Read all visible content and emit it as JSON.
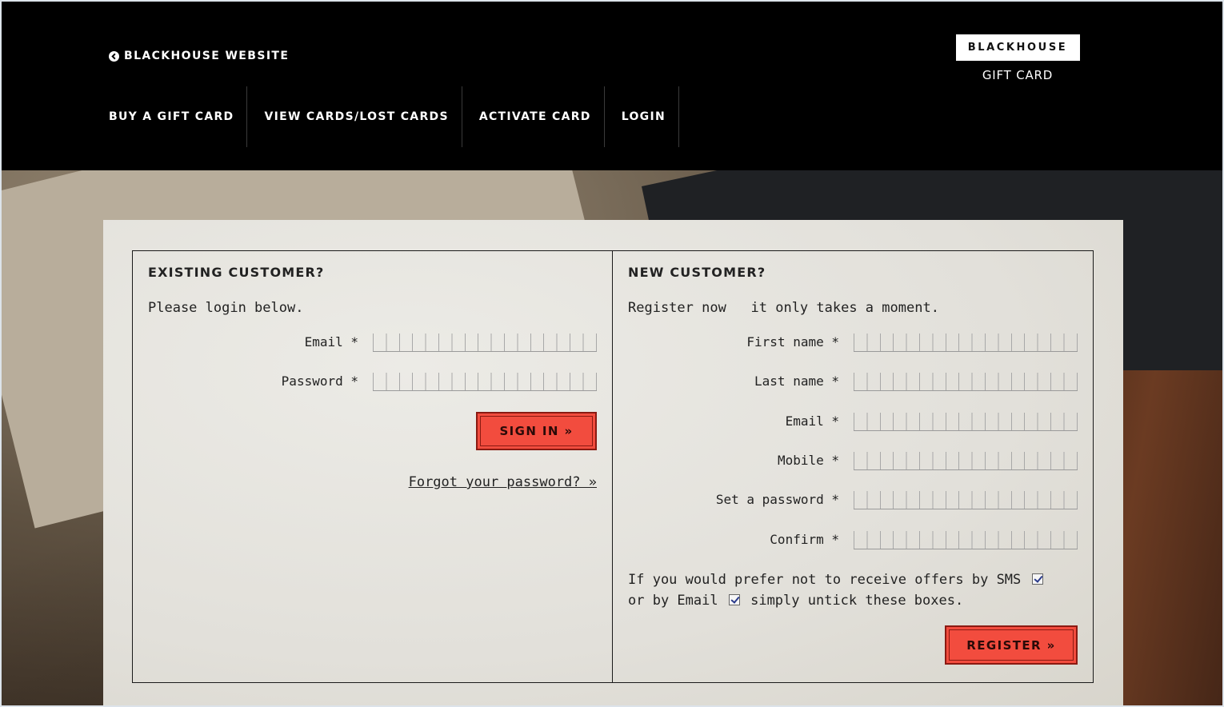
{
  "header": {
    "back_link": "BLACKHOUSE WEBSITE",
    "nav": [
      "BUY A GIFT CARD",
      "VIEW CARDS/LOST CARDS",
      "ACTIVATE CARD",
      "LOGIN"
    ],
    "logo_title": "BLACKHOUSE",
    "logo_sub": "GIFT CARD"
  },
  "existing": {
    "title": "EXISTING CUSTOMER?",
    "intro": "Please login below.",
    "fields": [
      "Email *",
      "Password *"
    ],
    "sign_in": "SIGN IN »",
    "forgot": "Forgot your password? »"
  },
  "new": {
    "title": "NEW CUSTOMER?",
    "intro": "Register now   it only takes a moment.",
    "fields": [
      "First name *",
      "Last name *",
      "Email *",
      "Mobile *",
      "Set a password *",
      "Confirm *"
    ],
    "optout_part1": "If you would prefer not to receive offers by SMS",
    "optout_part2": "or by Email",
    "optout_part3": "simply untick these boxes.",
    "sms_checked": true,
    "email_checked": true,
    "register": "REGISTER »"
  },
  "colors": {
    "header_bg": "#000000",
    "button": "#f24c3e"
  },
  "icons": [
    "chevron-left-circle-icon"
  ]
}
